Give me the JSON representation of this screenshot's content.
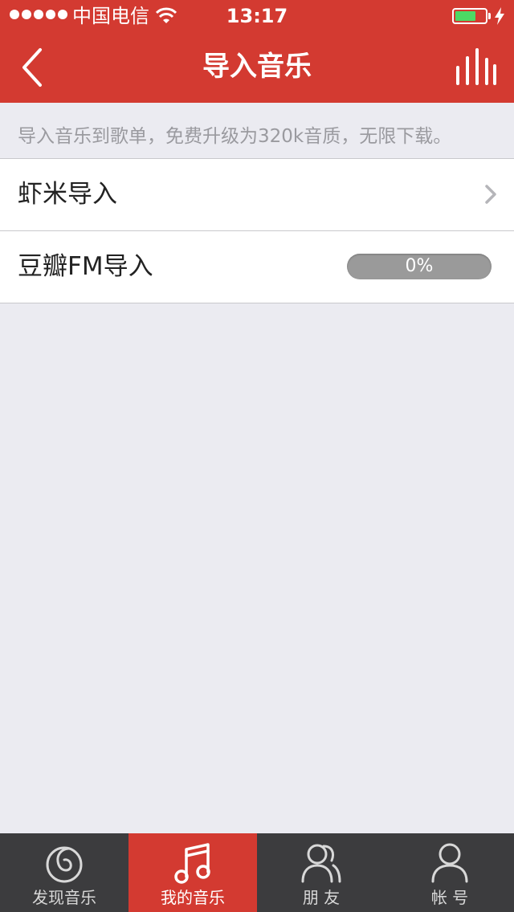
{
  "status_bar": {
    "carrier": "中国电信",
    "time": "13:17",
    "battery_level": 0.7
  },
  "nav": {
    "title": "导入音乐"
  },
  "hint": "导入音乐到歌单，免费升级为320k音质，无限下载。",
  "import_sources": [
    {
      "label": "虾米导入"
    },
    {
      "label": "豆瓣FM导入",
      "progress_text": "0%",
      "progress": 0
    }
  ],
  "tabs": [
    {
      "label": "发现音乐",
      "icon": "netease-logo-icon",
      "active": false
    },
    {
      "label": "我的音乐",
      "icon": "music-note-icon",
      "active": true
    },
    {
      "label": "朋 友",
      "icon": "friends-icon",
      "active": false
    },
    {
      "label": "帐 号",
      "icon": "account-icon",
      "active": false
    }
  ],
  "colors": {
    "brand_red": "#d33a31",
    "tabbar_dark": "#3c3c3e",
    "background": "#ebebf1",
    "battery_green": "#4cd964"
  }
}
